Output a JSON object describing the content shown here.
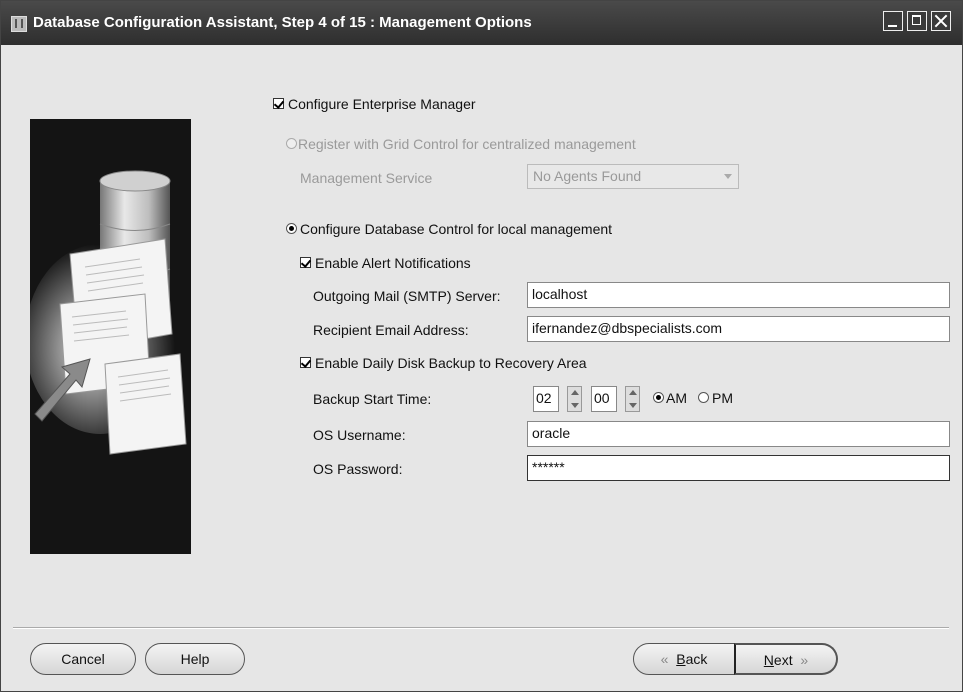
{
  "window": {
    "title": "Database Configuration Assistant, Step 4 of 15 : Management Options"
  },
  "form": {
    "configure_em_label": "Configure Enterprise Manager",
    "grid_control_label": "Register with Grid Control for centralized management",
    "management_service_label": "Management Service",
    "management_service_value": "No Agents Found",
    "db_control_label": "Configure Database Control for local management",
    "alert_notifications_label": "Enable Alert Notifications",
    "smtp_label": "Outgoing Mail (SMTP) Server:",
    "smtp_value": "localhost",
    "email_label": "Recipient Email Address:",
    "email_value": "ifernandez@dbspecialists.com",
    "daily_backup_label": "Enable Daily Disk Backup to Recovery Area",
    "backup_time_label": "Backup Start Time:",
    "backup_hour": "02",
    "backup_minute": "00",
    "am_label": "AM",
    "pm_label": "PM",
    "os_username_label": "OS Username:",
    "os_username_value": "oracle",
    "os_password_label": "OS Password:",
    "os_password_value": "******"
  },
  "buttons": {
    "cancel": "Cancel",
    "help": "Help",
    "back_b": "B",
    "back_rest": "ack",
    "next_n": "N",
    "next_rest": "ext"
  },
  "icons": {
    "back_chevron": "«",
    "next_chevron": "»"
  }
}
